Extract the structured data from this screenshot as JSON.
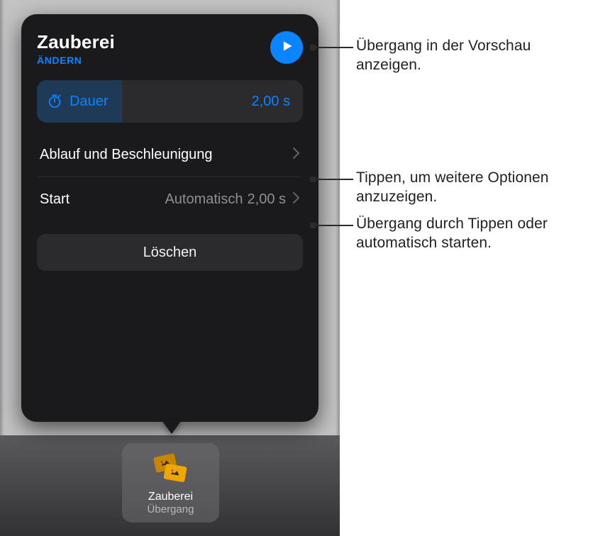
{
  "panel": {
    "title": "Zauberei",
    "change": "ÄNDERN",
    "duration": {
      "label": "Dauer",
      "value": "2,00 s"
    },
    "delivery": {
      "label": "Ablauf und Beschleunigung"
    },
    "start": {
      "label": "Start",
      "mode": "Automatisch",
      "value": "2,00 s"
    },
    "delete": "Löschen"
  },
  "chip": {
    "title": "Zauberei",
    "subtitle": "Übergang"
  },
  "callouts": {
    "preview": "Übergang in der Vorschau anzeigen.",
    "more": "Tippen, um weitere Optionen anzuzeigen.",
    "start": "Übergang durch Tippen oder automatisch starten."
  }
}
